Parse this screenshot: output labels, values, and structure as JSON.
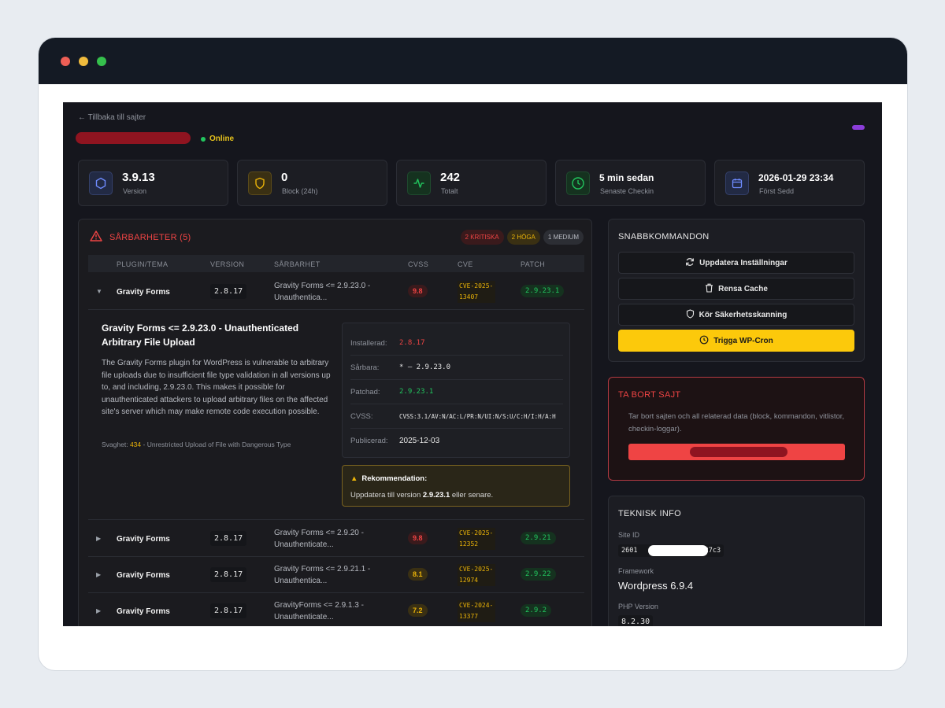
{
  "header": {
    "back_link": "← Tillbaka till sajter",
    "status": "Online"
  },
  "stats": [
    {
      "value": "3.9.13",
      "label": "Version",
      "icon": "hexagon-icon",
      "color": "#6f8cff"
    },
    {
      "value": "0",
      "label": "Block (24h)",
      "icon": "shield-icon",
      "color": "#eab308"
    },
    {
      "value": "242",
      "label": "Totalt",
      "icon": "activity-icon",
      "color": "#22c55e"
    },
    {
      "value": "5 min sedan",
      "label": "Senaste Checkin",
      "icon": "clock-icon",
      "color": "#22c55e"
    },
    {
      "value": "2026-01-29 23:34",
      "label": "Först Sedd",
      "icon": "calendar-icon",
      "color": "#6f8cff"
    }
  ],
  "vulnerabilities": {
    "title": "SÅRBARHETER (5)",
    "badges": [
      "2 KRITISKA",
      "2 HÖGA",
      "1 MEDIUM"
    ],
    "columns": [
      "PLUGIN/TEMA",
      "VERSION",
      "SÅRBARHET",
      "CVSS",
      "CVE",
      "PATCH"
    ],
    "rows": [
      {
        "plugin": "Gravity Forms",
        "version": "2.8.17",
        "vuln": "Gravity Forms <= 2.9.23.0 - Unauthentica...",
        "cvss": "9.8",
        "cve": "CVE-2025-13407",
        "patch": "2.9.23.1"
      },
      {
        "plugin": "Gravity Forms",
        "version": "2.8.17",
        "vuln": "Gravity Forms <= 2.9.20 - Unauthenticate...",
        "cvss": "9.8",
        "cve": "CVE-2025-12352",
        "patch": "2.9.21"
      },
      {
        "plugin": "Gravity Forms",
        "version": "2.8.17",
        "vuln": "Gravity Forms <= 2.9.21.1 - Unauthentica...",
        "cvss": "8.1",
        "cve": "CVE-2025-12974",
        "patch": "2.9.22"
      },
      {
        "plugin": "Gravity Forms",
        "version": "2.8.17",
        "vuln": "GravityForms <= 2.9.1.3 - Unauthenticate...",
        "cvss": "7.2",
        "cve": "CVE-2024-13377",
        "patch": "2.9.2"
      }
    ],
    "detail": {
      "title": "Gravity Forms <= 2.9.23.0 - Unauthenticated Arbitrary File Upload",
      "description": "The Gravity Forms plugin for WordPress is vulnerable to arbitrary file uploads due to insufficient file type validation in all versions up to, and including, 2.9.23.0. This makes it possible for unauthenticated attackers to upload arbitrary files on the affected site's server which may make remote code execution possible.",
      "weakness_label": "Svaghet:",
      "weakness_cwe": "434",
      "weakness_text": "- Unrestricted Upload of File with Dangerous Type",
      "fields": [
        {
          "key": "Installerad:",
          "value": "2.8.17"
        },
        {
          "key": "Sårbara:",
          "value": "* – 2.9.23.0"
        },
        {
          "key": "Patchad:",
          "value": "2.9.23.1"
        },
        {
          "key": "CVSS:",
          "value": "CVSS:3.1/AV:N/AC:L/PR:N/UI:N/S:U/C:H/I:H/A:H"
        },
        {
          "key": "Publicerad:",
          "value": "2025-12-03"
        }
      ],
      "recommendation_title": "Rekommendation:",
      "recommendation_prefix": "Uppdatera till version",
      "recommendation_version": "2.9.23.1",
      "recommendation_suffix": "eller senare."
    }
  },
  "quick_commands": {
    "title": "SNABBKOMMANDON",
    "buttons": [
      "Uppdatera Inställningar",
      "Rensa Cache",
      "Kör Säkerhetsskanning",
      "Trigga WP-Cron"
    ]
  },
  "remove_site": {
    "title": "TA BORT SAJT",
    "text": "Tar bort sajten och all relaterad data (block, kommandon, vitlistor, checkin-loggar)."
  },
  "tech_info": {
    "title": "TEKNISK INFO",
    "site_id_label": "Site ID",
    "site_id_start": "2601",
    "site_id_end": "e27c3",
    "framework_label": "Framework",
    "framework": "Wordpress 6.9.4",
    "php_label": "PHP Version",
    "php": "8.2.30"
  },
  "colors": {
    "accent": "#fcc90b",
    "danger": "#ef4444",
    "success": "#22c55e",
    "background": "#15161d"
  }
}
